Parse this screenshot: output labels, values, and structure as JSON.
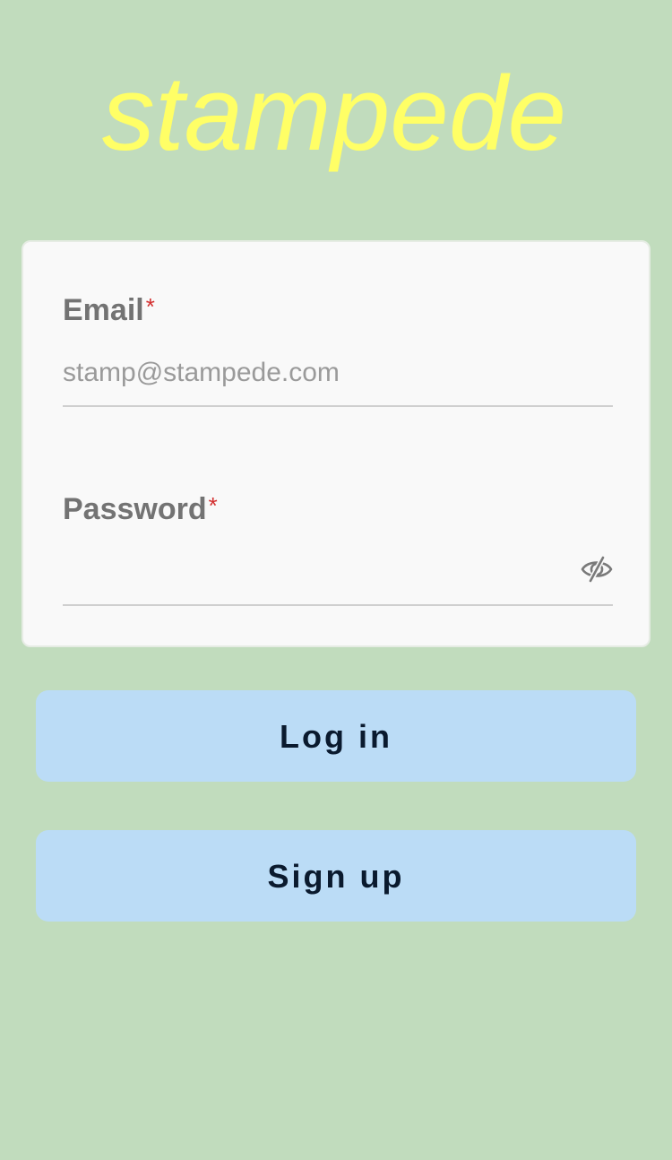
{
  "app": {
    "logo_text": "stampede"
  },
  "colors": {
    "background": "#c1dcbd",
    "logo": "#ffff66",
    "card": "#f9f9f9",
    "button": "#bbdcf6",
    "required": "#d32f2f"
  },
  "form": {
    "email": {
      "label": "Email",
      "required_mark": "*",
      "value": "",
      "placeholder": "stamp@stampede.com"
    },
    "password": {
      "label": "Password",
      "required_mark": "*",
      "value": "",
      "placeholder": "",
      "visibility_icon": "eye-off-icon"
    }
  },
  "actions": {
    "login_label": "Log in",
    "signup_label": "Sign up"
  }
}
